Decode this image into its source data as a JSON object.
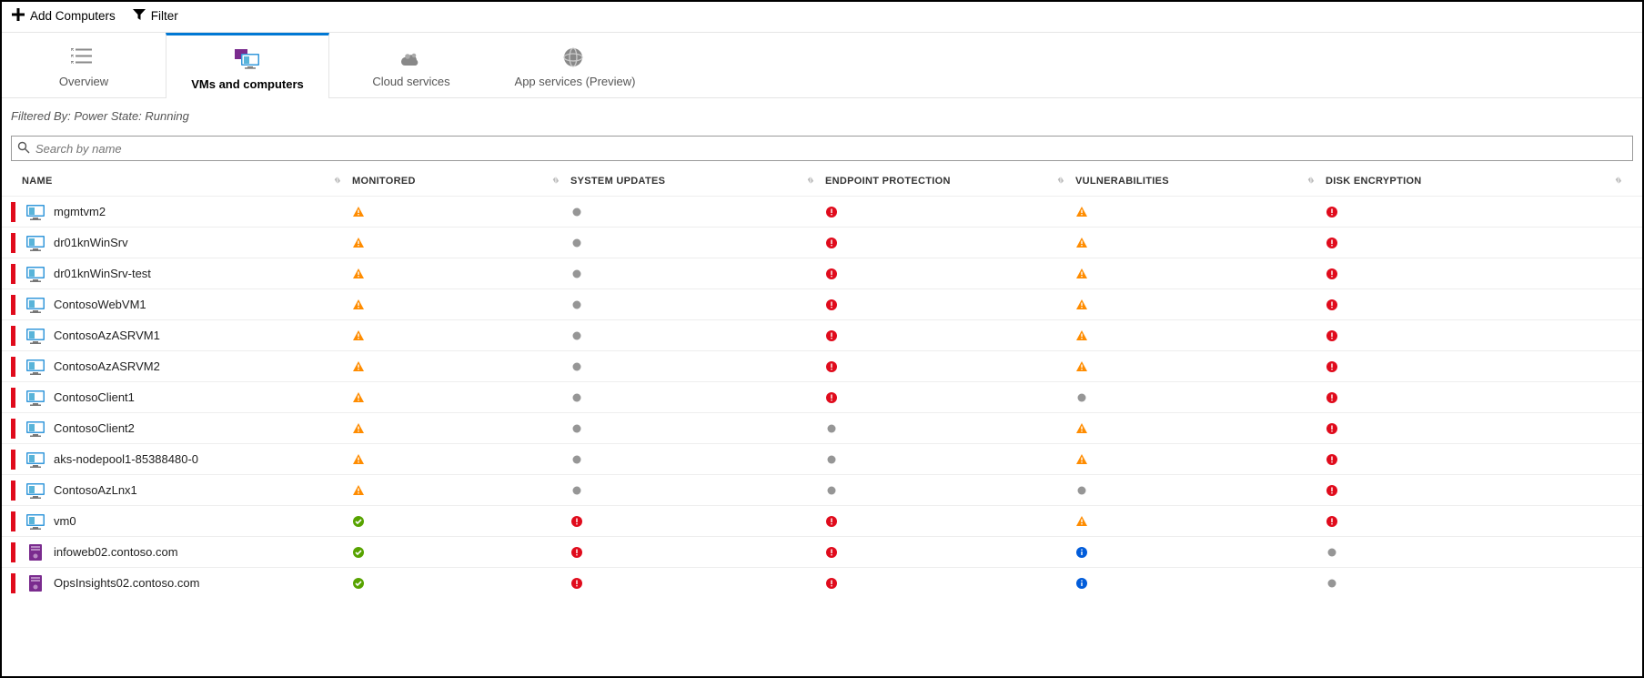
{
  "toolbar": {
    "add_label": "Add Computers",
    "filter_label": "Filter"
  },
  "tabs": [
    {
      "id": "overview",
      "label": "Overview",
      "icon": "list"
    },
    {
      "id": "vms",
      "label": "VMs and computers",
      "icon": "vm",
      "active": true
    },
    {
      "id": "cloud",
      "label": "Cloud services",
      "icon": "cloud"
    },
    {
      "id": "appsvc",
      "label": "App services (Preview)",
      "icon": "globe"
    }
  ],
  "filter_text": "Filtered By: Power State: Running",
  "search": {
    "placeholder": "Search by name"
  },
  "columns": {
    "name": "NAME",
    "monitored": "MONITORED",
    "system_updates": "SYSTEM UPDATES",
    "endpoint_protection": "ENDPOINT PROTECTION",
    "vulnerabilities": "VULNERABILITIES",
    "disk_encryption": "DISK ENCRYPTION"
  },
  "rows": [
    {
      "name": "mgmtvm2",
      "type": "vm",
      "monitored": "warn",
      "system_updates": "unknown",
      "endpoint_protection": "error",
      "vulnerabilities": "warn",
      "disk_encryption": "error"
    },
    {
      "name": "dr01knWinSrv",
      "type": "vm",
      "monitored": "warn",
      "system_updates": "unknown",
      "endpoint_protection": "error",
      "vulnerabilities": "warn",
      "disk_encryption": "error"
    },
    {
      "name": "dr01knWinSrv-test",
      "type": "vm",
      "monitored": "warn",
      "system_updates": "unknown",
      "endpoint_protection": "error",
      "vulnerabilities": "warn",
      "disk_encryption": "error"
    },
    {
      "name": "ContosoWebVM1",
      "type": "vm",
      "monitored": "warn",
      "system_updates": "unknown",
      "endpoint_protection": "error",
      "vulnerabilities": "warn",
      "disk_encryption": "error"
    },
    {
      "name": "ContosoAzASRVM1",
      "type": "vm",
      "monitored": "warn",
      "system_updates": "unknown",
      "endpoint_protection": "error",
      "vulnerabilities": "warn",
      "disk_encryption": "error"
    },
    {
      "name": "ContosoAzASRVM2",
      "type": "vm",
      "monitored": "warn",
      "system_updates": "unknown",
      "endpoint_protection": "error",
      "vulnerabilities": "warn",
      "disk_encryption": "error"
    },
    {
      "name": "ContosoClient1",
      "type": "vm",
      "monitored": "warn",
      "system_updates": "unknown",
      "endpoint_protection": "error",
      "vulnerabilities": "unknown",
      "disk_encryption": "error"
    },
    {
      "name": "ContosoClient2",
      "type": "vm",
      "monitored": "warn",
      "system_updates": "unknown",
      "endpoint_protection": "unknown",
      "vulnerabilities": "warn",
      "disk_encryption": "error"
    },
    {
      "name": "aks-nodepool1-85388480-0",
      "type": "vm",
      "monitored": "warn",
      "system_updates": "unknown",
      "endpoint_protection": "unknown",
      "vulnerabilities": "warn",
      "disk_encryption": "error"
    },
    {
      "name": "ContosoAzLnx1",
      "type": "vm",
      "monitored": "warn",
      "system_updates": "unknown",
      "endpoint_protection": "unknown",
      "vulnerabilities": "unknown",
      "disk_encryption": "error"
    },
    {
      "name": "vm0",
      "type": "vm",
      "monitored": "ok",
      "system_updates": "error",
      "endpoint_protection": "error",
      "vulnerabilities": "warn",
      "disk_encryption": "error"
    },
    {
      "name": "infoweb02.contoso.com",
      "type": "server",
      "monitored": "ok",
      "system_updates": "error",
      "endpoint_protection": "error",
      "vulnerabilities": "info",
      "disk_encryption": "unknown"
    },
    {
      "name": "OpsInsights02.contoso.com",
      "type": "server",
      "monitored": "ok",
      "system_updates": "error",
      "endpoint_protection": "error",
      "vulnerabilities": "info",
      "disk_encryption": "unknown"
    }
  ]
}
